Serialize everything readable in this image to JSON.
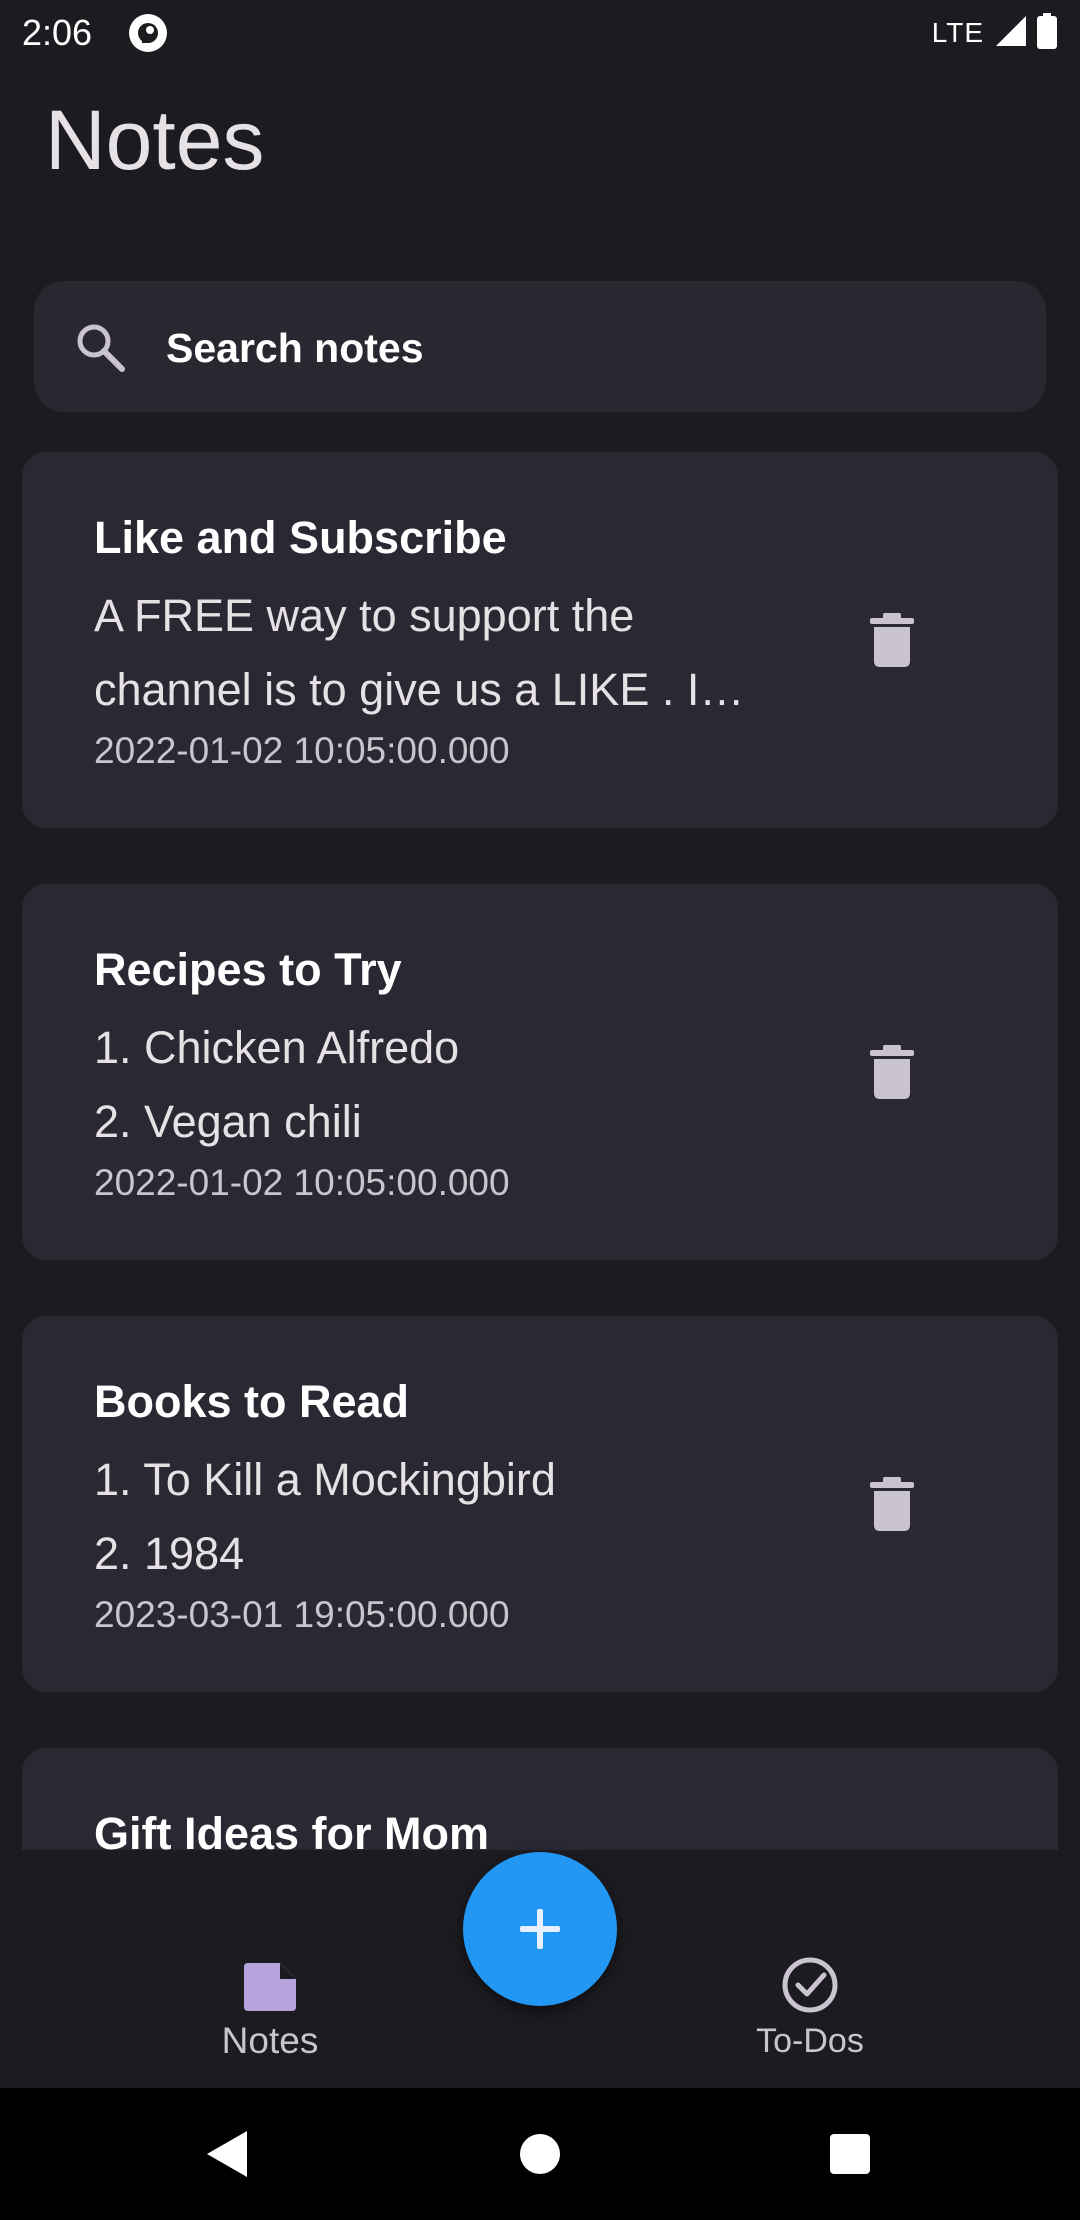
{
  "status_bar": {
    "time": "2:06",
    "network": "LTE",
    "app_icon": "pocket-casts-style-icon",
    "signal_icon": "signal-icon",
    "battery_icon": "battery-icon"
  },
  "page": {
    "title": "Notes"
  },
  "search": {
    "placeholder": "Search notes",
    "icon": "search-icon"
  },
  "notes": [
    {
      "title": "Like and Subscribe",
      "body": "A FREE way to support the channel is to give us a LIKE . I…",
      "date": "2022-01-02 10:05:00.000"
    },
    {
      "title": "Recipes to Try",
      "body": "1. Chicken Alfredo\n2. Vegan chili",
      "date": "2022-01-02 10:05:00.000"
    },
    {
      "title": "Books to Read",
      "body": "1. To Kill a Mockingbird\n2. 1984",
      "date": "2023-03-01 19:05:00.000"
    },
    {
      "title": "Gift Ideas for Mom",
      "body": "",
      "date": ""
    }
  ],
  "fab": {
    "icon": "plus-icon"
  },
  "bottom_nav": {
    "items": [
      {
        "label": "Notes",
        "icon": "note-icon",
        "selected": true
      },
      {
        "label": "To-Dos",
        "icon": "check-circle-icon",
        "selected": false
      }
    ]
  },
  "colors": {
    "background": "#1c1b20",
    "card": "#2a2832",
    "accent": "#2196f3"
  }
}
